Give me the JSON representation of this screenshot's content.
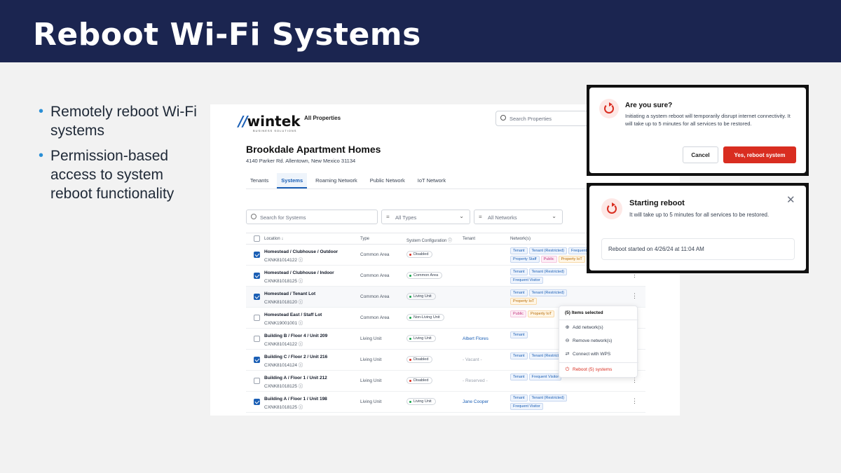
{
  "slide": {
    "title": "Reboot Wi-Fi Systems",
    "bullets": [
      "Remotely reboot Wi-Fi systems",
      "Permission-based access to system reboot functionality"
    ]
  },
  "app": {
    "logo": {
      "mark": "//",
      "word": "wintek",
      "sub": "BUSINESS SOLUTIONS"
    },
    "nav_all_properties": "All Properties",
    "search_properties_placeholder": "Search Properties",
    "property_title": "Brookdale Apartment Homes",
    "property_address": "4140 Parker Rd. Allentown, New Mexico 31134",
    "tabs": [
      "Tenants",
      "Systems",
      "Roaming Network",
      "Public Network",
      "IoT Network"
    ],
    "active_tab": "Systems",
    "filters": {
      "search_placeholder": "Search for Systems",
      "types": "All Types",
      "networks": "All Networks"
    },
    "table": {
      "headers": {
        "location": "Location ↓",
        "type": "Type",
        "config": "System Configuration ⓘ",
        "tenant": "Tenant",
        "networks": "Network(s)"
      },
      "rows": [
        {
          "location": "Homestead / Clubhouse / Outdoor",
          "serial": "CXNK81014122 ⓘ",
          "type": "Common Area",
          "config": "Disabled",
          "tenant": "",
          "networks": [
            "Tenant",
            "Tenant (Restricted)",
            "Frequent",
            "Property Staff",
            "Public",
            "Property IoT"
          ],
          "checked": true
        },
        {
          "location": "Homestead / Clubhouse / Indoor",
          "serial": "CXNK81018125 ⓘ",
          "type": "Common Area",
          "config": "Common Area",
          "tenant": "",
          "networks": [
            "Tenant",
            "Tenant (Restricted)",
            "Frequent Visitor"
          ],
          "checked": true
        },
        {
          "location": "Homestead / Tenant Lot",
          "serial": "CXNK81018120 ⓘ",
          "type": "Common Area",
          "config": "Living Unit",
          "tenant": "",
          "networks": [
            "Tenant",
            "Tenant (Restricted)",
            "Property IoT"
          ],
          "checked": true
        },
        {
          "location": "Homestead East / Staff Lot",
          "serial": "CXNK19001001 ⓘ",
          "type": "Common Area",
          "config": "Non-Living Unit",
          "tenant": "",
          "networks": [
            "Public",
            "Property IoT"
          ],
          "checked": false
        },
        {
          "location": "Building B / Floor 4 / Unit 209",
          "serial": "CXNK81014122 ⓘ",
          "type": "Living Unit",
          "config": "Living Unit",
          "tenant": "Albert Flores",
          "networks": [
            "Tenant"
          ],
          "checked": false
        },
        {
          "location": "Building C / Floor 2 / Unit 216",
          "serial": "CXNK81014124 ⓘ",
          "type": "Living Unit",
          "config": "Disabled",
          "tenant": "- Vacant -",
          "networks": [
            "Tenant",
            "Tenant (Restricted)"
          ],
          "checked": true
        },
        {
          "location": "Building A / Floor 1 / Unit 212",
          "serial": "CXNK81018125 ⓘ",
          "type": "Living Unit",
          "config": "Disabled",
          "tenant": "- Reserved -",
          "networks": [
            "Tenant",
            "Frequent Visitor"
          ],
          "checked": false
        },
        {
          "location": "Building A / Floor 1 / Unit 198",
          "serial": "CXNK81018125 ⓘ",
          "type": "Living Unit",
          "config": "Living Unit",
          "tenant": "Jane Cooper",
          "networks": [
            "Tenant",
            "Tenant (Restricted)",
            "Frequent Visitor"
          ],
          "checked": true
        }
      ]
    },
    "context_menu": {
      "header": "(5) Items selected",
      "items": [
        "Add network(s)",
        "Remove network(s)",
        "Connect with WPS",
        "Reboot (5) systems"
      ]
    }
  },
  "confirm_modal": {
    "title": "Are you sure?",
    "body": "Initiating a system reboot will temporarily disrupt internet connectivity. It will take up to 5 minutes for all services to be restored.",
    "cancel": "Cancel",
    "confirm": "Yes, reboot system"
  },
  "reboot_modal": {
    "title": "Starting reboot",
    "body": "It will take up to 5 minutes for all services to be restored.",
    "status": "Reboot started on 4/26/24 at 11:04 AM"
  },
  "colors": {
    "navy": "#1b2550",
    "brand_blue": "#1b5fb5",
    "danger": "#d92d20",
    "bullet": "#2a8fd6"
  }
}
